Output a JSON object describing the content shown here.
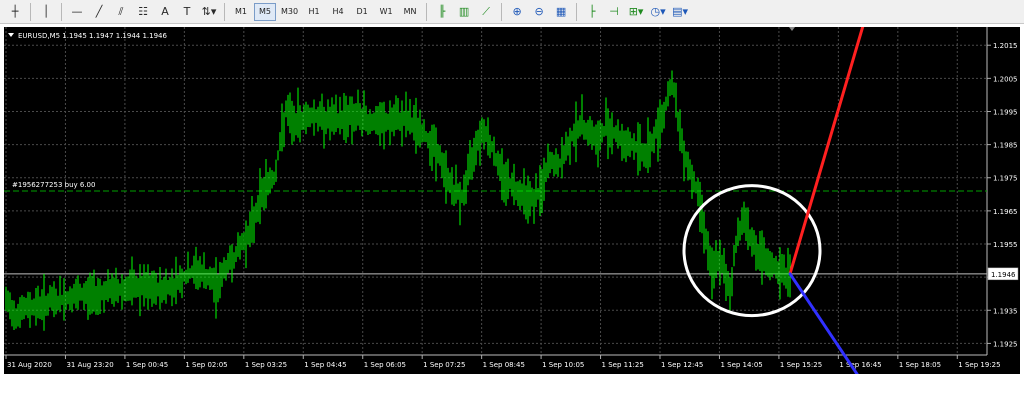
{
  "toolbar": {
    "items": [
      {
        "name": "crosshair-icon",
        "glyph": "┼"
      },
      {
        "sep": true
      },
      {
        "name": "vertical-line-icon",
        "glyph": "│"
      },
      {
        "sep": true
      },
      {
        "name": "horizontal-line-icon",
        "glyph": "—"
      },
      {
        "name": "trendline-icon",
        "glyph": "╱"
      },
      {
        "name": "channel-icon",
        "glyph": "⫽"
      },
      {
        "name": "fibonacci-icon",
        "glyph": "☷"
      },
      {
        "name": "text-icon",
        "glyph": "A"
      },
      {
        "name": "text-label-icon",
        "glyph": "T"
      },
      {
        "name": "arrows-icon",
        "glyph": "⇅▾"
      },
      {
        "sep": true
      }
    ],
    "timeframes": [
      "M1",
      "M5",
      "M30",
      "H1",
      "H4",
      "D1",
      "W1",
      "MN"
    ],
    "active_timeframe": "M5",
    "right_items": [
      {
        "name": "bar-chart-icon",
        "glyph": "╟",
        "color": "green"
      },
      {
        "name": "candlestick-icon",
        "glyph": "▥",
        "color": "green"
      },
      {
        "name": "line-chart-icon",
        "glyph": "⟋",
        "color": "green"
      },
      {
        "sep": true
      },
      {
        "name": "zoom-in-icon",
        "glyph": "⊕",
        "color": "blue"
      },
      {
        "name": "zoom-out-icon",
        "glyph": "⊖",
        "color": "blue"
      },
      {
        "name": "tile-windows-icon",
        "glyph": "▦",
        "color": "blue"
      },
      {
        "sep": true
      },
      {
        "name": "chart-shift-icon",
        "glyph": "├",
        "color": "green"
      },
      {
        "name": "autoscroll-icon",
        "glyph": "⊣",
        "color": "green"
      },
      {
        "name": "indicators-icon",
        "glyph": "⊞▾",
        "color": "green"
      },
      {
        "name": "periods-icon",
        "glyph": "◷▾",
        "color": "blue"
      },
      {
        "name": "templates-icon",
        "glyph": "▤▾",
        "color": "blue"
      }
    ]
  },
  "chart_data": {
    "type": "candlestick",
    "symbol_label": "EURUSD,M5  1.1945 1.1947 1.1944 1.1946",
    "order_label": "#1956277253 buy 6.00",
    "order_price": 1.1971,
    "current_price": 1.1946,
    "current_price_label": "1.1946",
    "ylim": [
      1.19215,
      1.20205
    ],
    "y_ticks": [
      "1.2015",
      "1.2005",
      "1.1995",
      "1.1985",
      "1.1975",
      "1.1965",
      "1.1955",
      "1.1945",
      "1.1935",
      "1.1925"
    ],
    "x_ticks": [
      "31 Aug 2020",
      "31 Aug 23:20",
      "1 Sep 00:45",
      "1 Sep 02:05",
      "1 Sep 03:25",
      "1 Sep 04:45",
      "1 Sep 06:05",
      "1 Sep 07:25",
      "1 Sep 08:45",
      "1 Sep 10:05",
      "1 Sep 11:25",
      "1 Sep 12:45",
      "1 Sep 14:05",
      "1 Sep 15:25",
      "1 Sep 16:45",
      "1 Sep 18:05",
      "1 Sep 19:25"
    ],
    "price_path": [
      [
        0,
        1.1938
      ],
      [
        12,
        1.1934
      ],
      [
        25,
        1.1936
      ],
      [
        40,
        1.1937
      ],
      [
        55,
        1.1938
      ],
      [
        70,
        1.1939
      ],
      [
        90,
        1.194
      ],
      [
        110,
        1.1941
      ],
      [
        130,
        1.1942
      ],
      [
        150,
        1.1941
      ],
      [
        165,
        1.1942
      ],
      [
        175,
        1.1944
      ],
      [
        185,
        1.1946
      ],
      [
        195,
        1.1947
      ],
      [
        205,
        1.1944
      ],
      [
        213,
        1.1942
      ],
      [
        222,
        1.1948
      ],
      [
        232,
        1.1952
      ],
      [
        240,
        1.1956
      ],
      [
        248,
        1.196
      ],
      [
        255,
        1.1968
      ],
      [
        262,
        1.1973
      ],
      [
        270,
        1.1975
      ],
      [
        276,
        1.1985
      ],
      [
        282,
        1.1995
      ],
      [
        290,
        1.1991
      ],
      [
        298,
        1.1993
      ],
      [
        308,
        1.1994
      ],
      [
        318,
        1.1993
      ],
      [
        330,
        1.1992
      ],
      [
        345,
        1.1994
      ],
      [
        360,
        1.1993
      ],
      [
        375,
        1.1991
      ],
      [
        390,
        1.1992
      ],
      [
        400,
        1.1993
      ],
      [
        410,
        1.1991
      ],
      [
        420,
        1.1988
      ],
      [
        432,
        1.1984
      ],
      [
        440,
        1.1977
      ],
      [
        450,
        1.1971
      ],
      [
        458,
        1.1969
      ],
      [
        465,
        1.1977
      ],
      [
        472,
        1.1986
      ],
      [
        480,
        1.199
      ],
      [
        487,
        1.1985
      ],
      [
        495,
        1.1978
      ],
      [
        503,
        1.1974
      ],
      [
        512,
        1.1972
      ],
      [
        522,
        1.197
      ],
      [
        530,
        1.1968
      ],
      [
        538,
        1.1972
      ],
      [
        546,
        1.198
      ],
      [
        554,
        1.1978
      ],
      [
        562,
        1.1983
      ],
      [
        570,
        1.1989
      ],
      [
        578,
        1.1991
      ],
      [
        586,
        1.1989
      ],
      [
        594,
        1.1985
      ],
      [
        602,
        1.1991
      ],
      [
        610,
        1.1989
      ],
      [
        618,
        1.1986
      ],
      [
        626,
        1.1985
      ],
      [
        634,
        1.1984
      ],
      [
        642,
        1.1982
      ],
      [
        650,
        1.1987
      ],
      [
        658,
        1.1993
      ],
      [
        664,
        1.2
      ],
      [
        668,
        1.2005
      ],
      [
        674,
        1.1992
      ],
      [
        680,
        1.1983
      ],
      [
        686,
        1.1977
      ],
      [
        692,
        1.1972
      ],
      [
        698,
        1.1965
      ],
      [
        703,
        1.1955
      ],
      [
        708,
        1.1945
      ],
      [
        714,
        1.1951
      ],
      [
        720,
        1.1946
      ],
      [
        726,
        1.1941
      ],
      [
        732,
        1.1955
      ],
      [
        738,
        1.1963
      ],
      [
        744,
        1.196
      ],
      [
        750,
        1.1954
      ],
      [
        756,
        1.1951
      ],
      [
        762,
        1.1949
      ],
      [
        770,
        1.1948
      ],
      [
        778,
        1.1946
      ],
      [
        786,
        1.1946
      ]
    ],
    "projections": [
      {
        "name": "up-projection",
        "color": "#ff2020",
        "from": [
          786,
          1.1946
        ],
        "to": [
          865,
          1.2027
        ]
      },
      {
        "name": "down-projection",
        "color": "#3030ff",
        "from": [
          786,
          1.1946
        ],
        "to": [
          868,
          1.1909
        ]
      }
    ],
    "highlight_circle": {
      "center": [
        748,
        1.1953
      ],
      "radius": [
        68,
        26
      ]
    },
    "colors": {
      "background": "#000000",
      "grid": "#4a4a4a",
      "candles": "#00ff00",
      "order_line": "#00a000",
      "price_line": "#c0c0c0",
      "text": "#ffffff"
    }
  }
}
